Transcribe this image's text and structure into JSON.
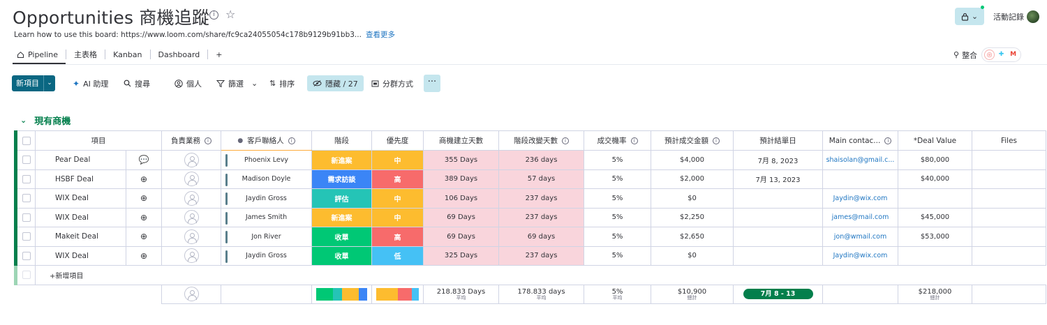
{
  "board": {
    "title": "Opportunities 商機追蹤",
    "description": "Learn how to use this board: https://www.loom.com/share/fc9ca24055054c178b9129b91bb3...",
    "see_more": "查看更多"
  },
  "topbar": {
    "activity_label": "活動記錄"
  },
  "tabs": [
    {
      "label": "Pipeline",
      "icon": "home-icon"
    },
    {
      "label": "主表格"
    },
    {
      "label": "Kanban"
    },
    {
      "label": "Dashboard"
    },
    {
      "label": "+"
    }
  ],
  "integrations": {
    "label": "整合"
  },
  "toolbar": {
    "new_item": "新項目",
    "ai": "AI 助理",
    "search": "搜尋",
    "person": "個人",
    "filter": "篩選",
    "sort": "排序",
    "hidden": "隱藏 / 27",
    "group_by": "分群方式",
    "more": "···"
  },
  "group": {
    "name": "現有商機",
    "color": "#037f4c"
  },
  "columns": [
    {
      "label": "項目"
    },
    {
      "label": "負責業務"
    },
    {
      "label": "客戶聯絡人"
    },
    {
      "label": "階段"
    },
    {
      "label": "優先度"
    },
    {
      "label": "商機建立天數"
    },
    {
      "label": "階段改變天數"
    },
    {
      "label": "成交機率"
    },
    {
      "label": "預計成交金額"
    },
    {
      "label": "預計結單日"
    },
    {
      "label": "Main contac..."
    },
    {
      "label": "*Deal Value"
    },
    {
      "label": "Files"
    }
  ],
  "rows": [
    {
      "name": "Pear Deal",
      "contact": "Phoenix Levy",
      "stage": "新進案",
      "stage_color": "#fdbc2f",
      "priority": "中",
      "priority_color": "#fdbc2f",
      "created_days": "355 Days",
      "stage_days": "236 days",
      "probability": "5%",
      "amount": "$4,000",
      "close_date": "7月 8, 2023",
      "email": "shaisolan@gmail.c...",
      "deal_value": "$80,000"
    },
    {
      "name": "HSBF Deal",
      "contact": "Madison Doyle",
      "stage": "需求訪談",
      "stage_color": "#3b85f6",
      "priority": "高",
      "priority_color": "#f76b6b",
      "created_days": "389 Days",
      "stage_days": "57 days",
      "probability": "5%",
      "amount": "$2,000",
      "close_date": "7月 13, 2023",
      "email": "",
      "deal_value": "$40,000"
    },
    {
      "name": "WIX Deal",
      "contact": "Jaydin Gross",
      "stage": "評估",
      "stage_color": "#25c4b6",
      "priority": "中",
      "priority_color": "#fdbc2f",
      "created_days": "106 Days",
      "stage_days": "237 days",
      "probability": "5%",
      "amount": "$0",
      "close_date": "",
      "email": "Jaydin@wix.com",
      "deal_value": ""
    },
    {
      "name": "WIX Deal",
      "contact": "James Smith",
      "stage": "新進案",
      "stage_color": "#fdbc2f",
      "priority": "中",
      "priority_color": "#fdbc2f",
      "created_days": "69 Days",
      "stage_days": "237 days",
      "probability": "5%",
      "amount": "$2,250",
      "close_date": "",
      "email": "james@mail.com",
      "deal_value": "$45,000"
    },
    {
      "name": "Makeit Deal",
      "contact": "Jon River",
      "stage": "收單",
      "stage_color": "#00c875",
      "priority": "高",
      "priority_color": "#f76b6b",
      "created_days": "69 Days",
      "stage_days": "69 days",
      "probability": "5%",
      "amount": "$2,650",
      "close_date": "",
      "email": "jon@wmail.com",
      "deal_value": "$53,000"
    },
    {
      "name": "WIX Deal",
      "contact": "Jaydin Gross",
      "stage": "收單",
      "stage_color": "#00c875",
      "priority": "低",
      "priority_color": "#45c1f5",
      "created_days": "325 Days",
      "stage_days": "237 days",
      "probability": "5%",
      "amount": "$0",
      "close_date": "",
      "email": "Jaydin@wix.com",
      "deal_value": ""
    }
  ],
  "add_item": "+新增項目",
  "summary": {
    "created_days": "218.833 Days",
    "created_label": "平均",
    "stage_days": "178.833 days",
    "stage_label": "平均",
    "probability": "5%",
    "probability_label": "平均",
    "amount": "$10,900",
    "amount_label": "總計",
    "date_range": "7月 8 - 13",
    "deal_value": "$218,000",
    "deal_value_label": "總計",
    "stage_distribution": [
      {
        "color": "#00c875",
        "fraction": 0.33
      },
      {
        "color": "#25c4b6",
        "fraction": 0.17
      },
      {
        "color": "#fdbc2f",
        "fraction": 0.33
      },
      {
        "color": "#3b85f6",
        "fraction": 0.17
      }
    ],
    "priority_distribution": [
      {
        "color": "#fdbc2f",
        "fraction": 0.5
      },
      {
        "color": "#f76b6b",
        "fraction": 0.33
      },
      {
        "color": "#45c1f5",
        "fraction": 0.17
      }
    ]
  }
}
